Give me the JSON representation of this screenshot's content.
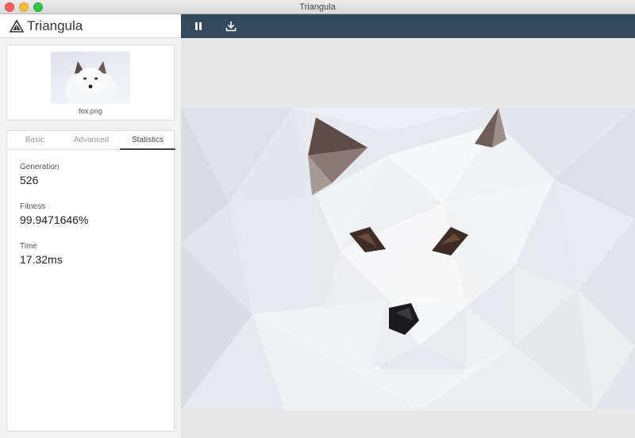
{
  "window": {
    "title": "Triangula"
  },
  "app": {
    "name": "Triangula",
    "logo_icon": "triangula-logo-icon"
  },
  "thumbnail": {
    "filename": "fox.png"
  },
  "tabs": [
    {
      "label": "Basic",
      "active": false
    },
    {
      "label": "Advanced",
      "active": false
    },
    {
      "label": "Statistics",
      "active": true
    }
  ],
  "stats": {
    "generation": {
      "label": "Generation",
      "value": "526"
    },
    "fitness": {
      "label": "Fitness",
      "value": "99.9471646%"
    },
    "time": {
      "label": "Time",
      "value": "17.32ms"
    }
  },
  "toolbar": {
    "pause_icon": "pause-icon",
    "download_icon": "download-icon",
    "color": "#34495e"
  }
}
